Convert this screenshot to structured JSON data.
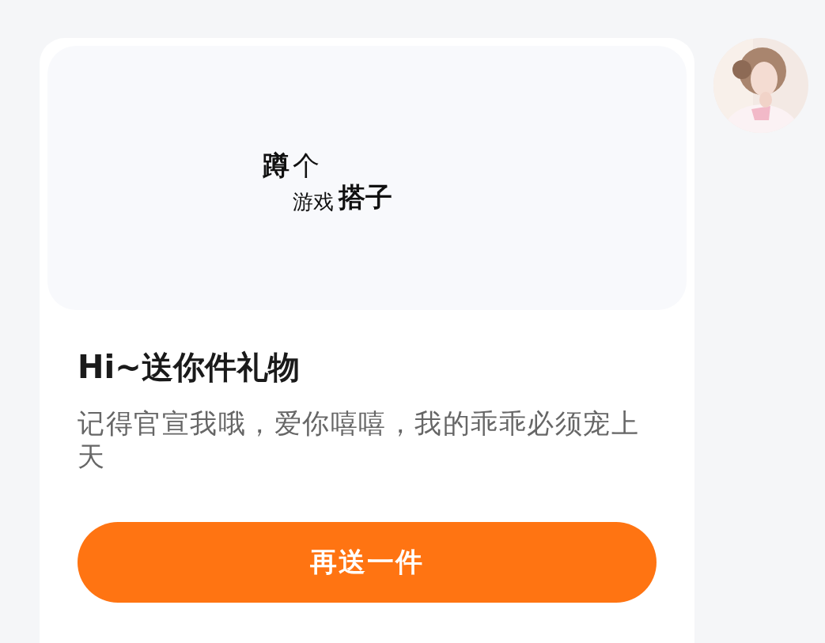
{
  "gift": {
    "caption_top": [
      "蹲",
      "个"
    ],
    "caption_bottom": [
      "游戏",
      "搭子"
    ]
  },
  "title": "Hi~送你件礼物",
  "message": "记得官宣我哦，爱你嘻嘻，我的乖乖必须宠上天",
  "button": "再送一件"
}
